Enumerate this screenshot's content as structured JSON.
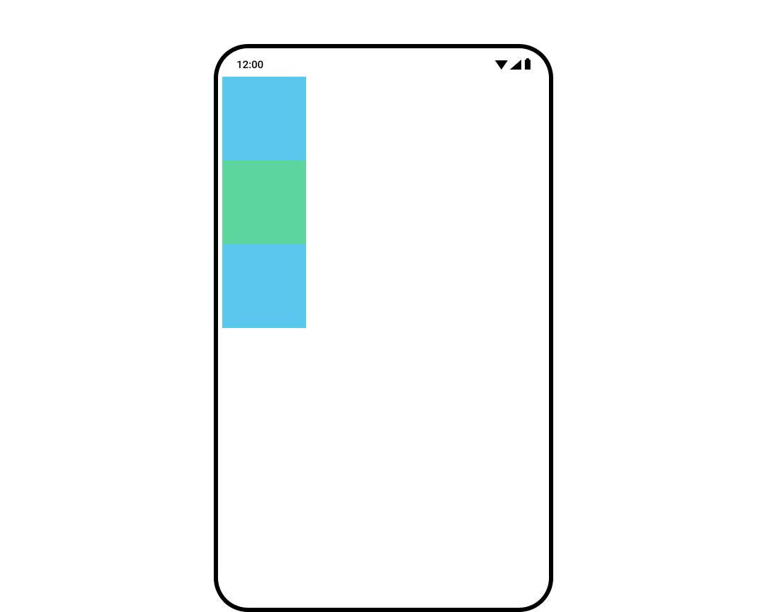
{
  "status_bar": {
    "time": "12:00"
  },
  "blocks": {
    "top": {
      "color": "#5ac8ed"
    },
    "middle": {
      "color": "#5dd69e"
    },
    "bottom": {
      "color": "#5ac8ed"
    }
  }
}
